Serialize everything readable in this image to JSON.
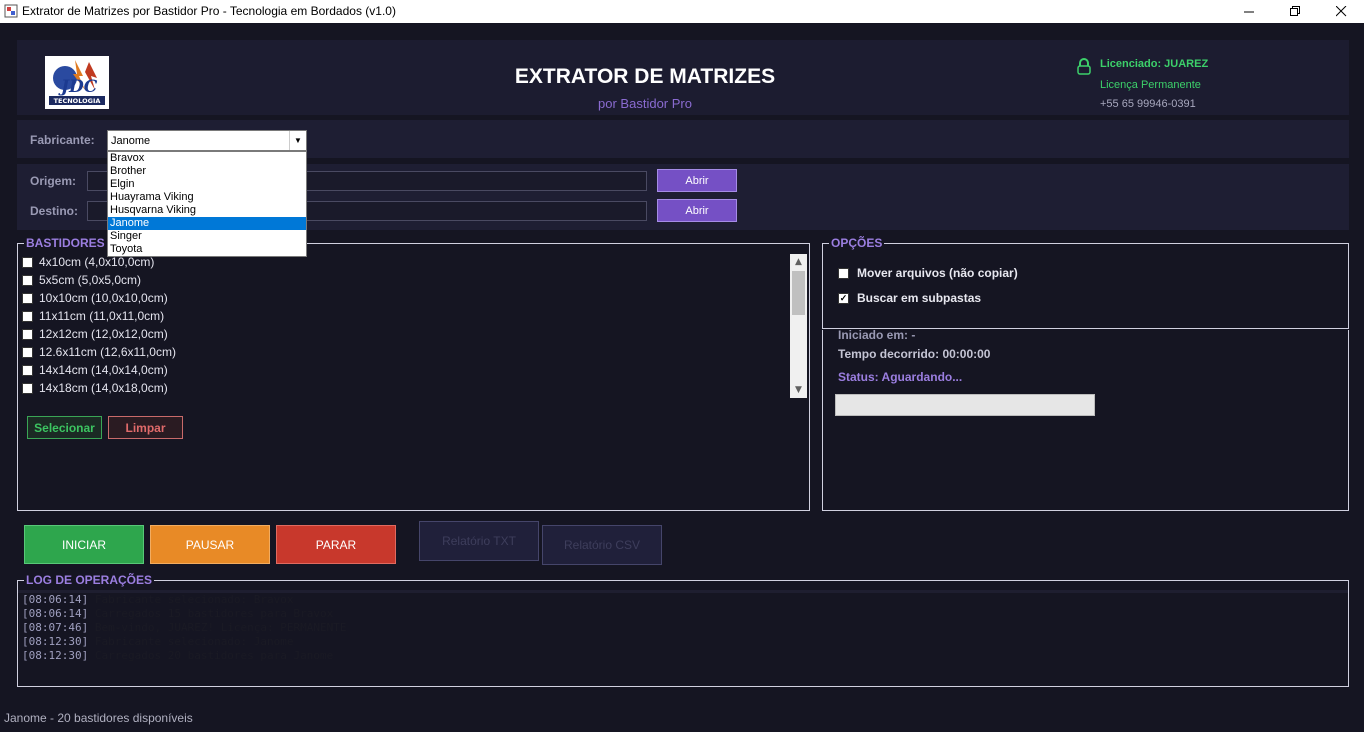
{
  "window": {
    "title": "Extrator de Matrizes por Bastidor Pro - Tecnologia em Bordados (v1.0)"
  },
  "header": {
    "title": "EXTRATOR DE MATRIZES",
    "subtitle": "por Bastidor Pro",
    "logo_text": "JDC",
    "logo_subtext": "TECNOLOGIA",
    "license_user": "Licenciado: JUAREZ",
    "license_type": "Licença Permanente",
    "phone": "+55 65 99946-0391"
  },
  "fabricante": {
    "label": "Fabricante:",
    "selected": "Janome",
    "options": [
      "Bravox",
      "Brother",
      "Elgin",
      "Huayrama Viking",
      "Husqvarna Viking",
      "Janome",
      "Singer",
      "Toyota"
    ],
    "selected_index": 5
  },
  "origem": {
    "label": "Origem:",
    "value": "",
    "button": "Abrir"
  },
  "destino": {
    "label": "Destino:",
    "value": "",
    "button": "Abrir"
  },
  "bastidores": {
    "title": "BASTIDORES D",
    "items": [
      {
        "label": "4x10cm (4,0x10,0cm)",
        "checked": false
      },
      {
        "label": "5x5cm (5,0x5,0cm)",
        "checked": false
      },
      {
        "label": "10x10cm (10,0x10,0cm)",
        "checked": false
      },
      {
        "label": "11x11cm (11,0x11,0cm)",
        "checked": false
      },
      {
        "label": "12x12cm (12,0x12,0cm)",
        "checked": false
      },
      {
        "label": "12.6x11cm (12,6x11,0cm)",
        "checked": false
      },
      {
        "label": "14x14cm (14,0x14,0cm)",
        "checked": false
      },
      {
        "label": "14x18cm (14,0x18,0cm)",
        "checked": false
      }
    ],
    "select_button": "Selecionar",
    "clear_button": "Limpar"
  },
  "opcoes": {
    "title": "OPÇÕES",
    "move_files": {
      "label": "Mover arquivos (não copiar)",
      "checked": false
    },
    "subfolders": {
      "label": "Buscar em subpastas",
      "checked": true
    }
  },
  "status": {
    "started": "Iniciado em: -",
    "elapsed": "Tempo decorrido: 00:00:00",
    "status": "Status: Aguardando...",
    "progress": 0
  },
  "actions": {
    "start": "INICIAR",
    "pause": "PAUSAR",
    "stop": "PARAR",
    "report_txt": "Relatório TXT",
    "report_csv": "Relatório CSV"
  },
  "log": {
    "title": "LOG DE OPERAÇÕES",
    "lines": [
      {
        "time": "[08:06:14]",
        "msg": "Fabricante selecionado: Bravox"
      },
      {
        "time": "[08:06:14]",
        "msg": "Carregados 15 bastidores para Bravox"
      },
      {
        "time": "[08:07:46]",
        "msg": "Bem-vindo, JUAREZ! Licença: PERMANENTE"
      },
      {
        "time": "[08:12:30]",
        "msg": "Fabricante selecionado: Janome"
      },
      {
        "time": "[08:12:30]",
        "msg": "Carregados 20 bastidores para Janome"
      }
    ]
  },
  "statusbar": {
    "text": "Janome - 20 bastidores disponíveis"
  },
  "colors": {
    "accent": "#7550c5",
    "start": "#2ea64d",
    "pause": "#e88a26",
    "stop": "#c8382c",
    "license": "#3cd06a"
  }
}
